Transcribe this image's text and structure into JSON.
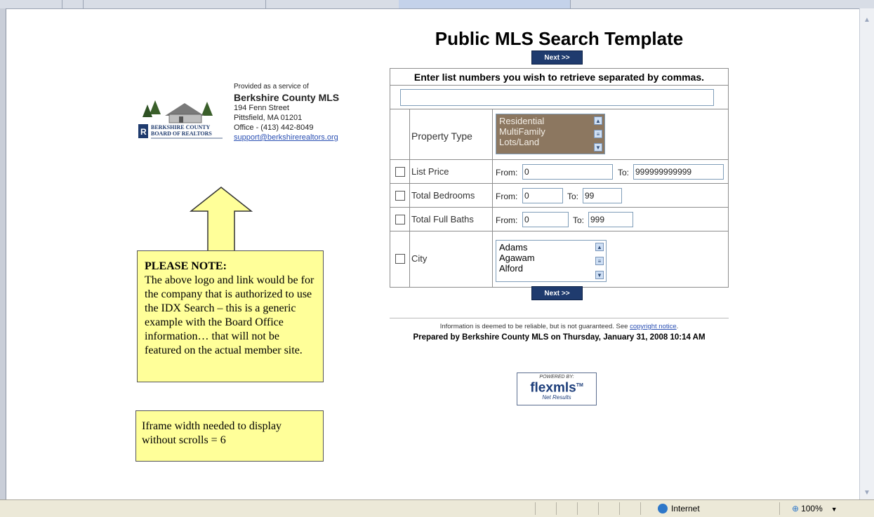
{
  "page": {
    "title": "Public MLS Search Template",
    "next_label": "Next >>"
  },
  "provider": {
    "service_text": "Provided as a service of",
    "org": "Berkshire County MLS",
    "address1": "194 Fenn Street",
    "address2": "Pittsfield, MA 01201",
    "phone": "Office - (413) 442-8049",
    "email": "support@berkshirerealtors.org",
    "logo_text": "BERKSHIRE COUNTY BOARD OF REALTORS"
  },
  "form": {
    "instructions": "Enter list numbers you wish to retrieve separated by commas.",
    "list_numbers_value": "",
    "property_type": {
      "label": "Property Type",
      "options": [
        "Residential",
        "MultiFamily",
        "Lots/Land"
      ]
    },
    "list_price": {
      "label": "List Price",
      "from_label": "From:",
      "from": "0",
      "to_label": "To:",
      "to": "999999999999"
    },
    "bedrooms": {
      "label": "Total Bedrooms",
      "from_label": "From:",
      "from": "0",
      "to_label": "To:",
      "to": "99"
    },
    "baths": {
      "label": "Total Full Baths",
      "from_label": "From:",
      "from": "0",
      "to_label": "To:",
      "to": "999"
    },
    "city": {
      "label": "City",
      "options": [
        "Adams",
        "Agawam",
        "Alford"
      ]
    }
  },
  "footer": {
    "disclaimer": "Information is deemed to be reliable, but is not guaranteed. See",
    "copyright_link": "copyright notice",
    "disclaimer_end": ".",
    "prepared": "Prepared by Berkshire County MLS on Thursday, January 31, 2008 10:14 AM"
  },
  "badge": {
    "powered": "POWERED BY:",
    "brand": "flexmls",
    "tm": "TM",
    "tagline": "Net Results"
  },
  "notes": {
    "heading": "PLEASE NOTE:",
    "body": "The above logo and link would be for the company that is authorized to use the IDX Search – this is a generic example with the Board Office information… that will not be featured on the actual member site.",
    "iframe": "Iframe width needed to display without scrolls = 6"
  },
  "statusbar": {
    "zone": "Internet",
    "zoom": "100%"
  },
  "colors": {
    "button_bg": "#1f3b6e",
    "note_bg": "#ffff99",
    "selected_list_bg": "#8c7760",
    "link": "#2a4fb3"
  }
}
